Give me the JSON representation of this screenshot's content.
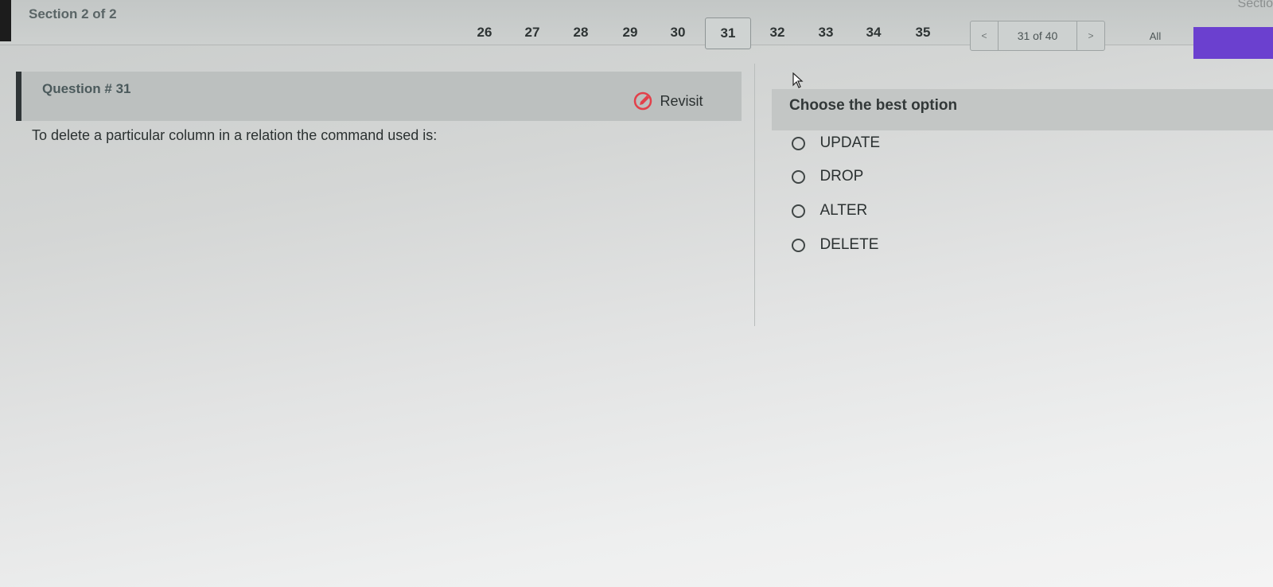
{
  "header": {
    "section_label": "Section 2 of 2",
    "corner_label": "Sectio",
    "pages": [
      "26",
      "27",
      "28",
      "29",
      "30",
      "31",
      "32",
      "33",
      "34",
      "35"
    ],
    "current_page": "31",
    "prev_label": "<",
    "next_label": ">",
    "status": "31 of 40",
    "all_label": "All"
  },
  "question": {
    "title": "Question # 31",
    "revisit_label": "Revisit",
    "text": "To delete a particular column in a relation the command used is:"
  },
  "answers": {
    "title": "Choose the best option",
    "options": [
      "UPDATE",
      "DROP",
      "ALTER",
      "DELETE"
    ]
  },
  "colors": {
    "accent": "#6b40cf",
    "revisit_icon": "#e2404a"
  },
  "icons": {
    "revisit": "revisit-pencil-icon",
    "cursor": "mouse-pointer-icon"
  }
}
